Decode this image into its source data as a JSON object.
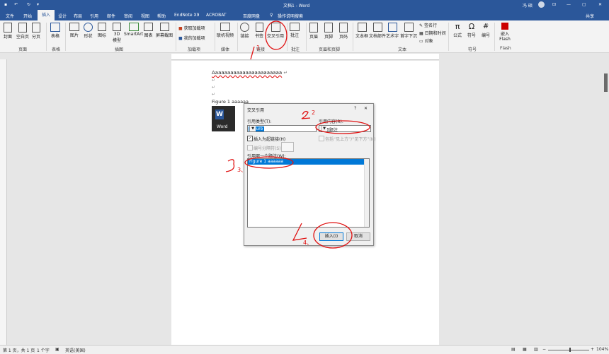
{
  "titlebar": {
    "save_label": "保存",
    "doc_title": "文档1 - Word",
    "user": "冯 硕",
    "close": "✕",
    "minimize": "—",
    "restore": "▢",
    "options": "⊡"
  },
  "tabs": [
    "文件",
    "开始",
    "插入",
    "设计",
    "布局",
    "引用",
    "邮件",
    "审阅",
    "视图",
    "帮助",
    "EndNote X9",
    "ACROBAT",
    "百度网盘",
    "操作说明搜索"
  ],
  "share_label": "共享",
  "ribbon": {
    "page_buttons": [
      "封面",
      "空白页",
      "分页"
    ],
    "table": "表格",
    "illus": [
      "图片",
      "形状",
      "图标",
      "3D模型",
      "SmartArt",
      "图表",
      "屏幕截图"
    ],
    "addins": [
      "获取加载项",
      "我的加载项"
    ],
    "media": "联机视频",
    "links": [
      "链接",
      "书签",
      "交叉引用"
    ],
    "comment": "批注",
    "hf": [
      "页眉",
      "页脚",
      "页码"
    ],
    "text_buttons": [
      "文本框",
      "文档部件",
      "艺术字",
      "首字下沉"
    ],
    "text_small": [
      "签名行",
      "日期和时间",
      "对象"
    ],
    "symbols": [
      "公式",
      "符号",
      "编号"
    ],
    "flash": "嵌入Flash",
    "groups": [
      "页面",
      "表格",
      "插图",
      "加载项",
      "媒体",
      "链接",
      "批注",
      "页眉和页脚",
      "文本",
      "符号",
      "Flash"
    ]
  },
  "document": {
    "line1": "Aaaaaaaaaaaaaaaaaaaaaaa",
    "para_marks": [
      "↵",
      "↵",
      "↵"
    ],
    "caption": "Figure 1  aaaaaa",
    "word_label": "Word"
  },
  "dialog": {
    "title": "交叉引用",
    "help": "?",
    "close": "✕",
    "ref_type_label": "引用类型(T):",
    "ref_type_value": "Figure",
    "ref_content_label": "引用内容(R):",
    "ref_content_value": "整项题注",
    "hyperlink_label": "插入为超链接(H)",
    "above_below_label": "包括“见上方”/“见下方”(N)",
    "separator_label": "编号分隔符(S)",
    "which_label": "引用哪一个题注(W):",
    "list_items": [
      "Figure 1  aaaaaa"
    ],
    "insert_button": "插入(I)",
    "cancel_button": "取消"
  },
  "annotations": [
    "1",
    "2",
    "3、",
    "4、"
  ],
  "status": {
    "page": "第 1 页，共 1 页",
    "words": "1 个字",
    "lang": "英语(美国)",
    "zoom": "104%"
  },
  "colors": {
    "accent": "#2b579a",
    "annotation": "#e01010",
    "selection": "#0078d7"
  }
}
